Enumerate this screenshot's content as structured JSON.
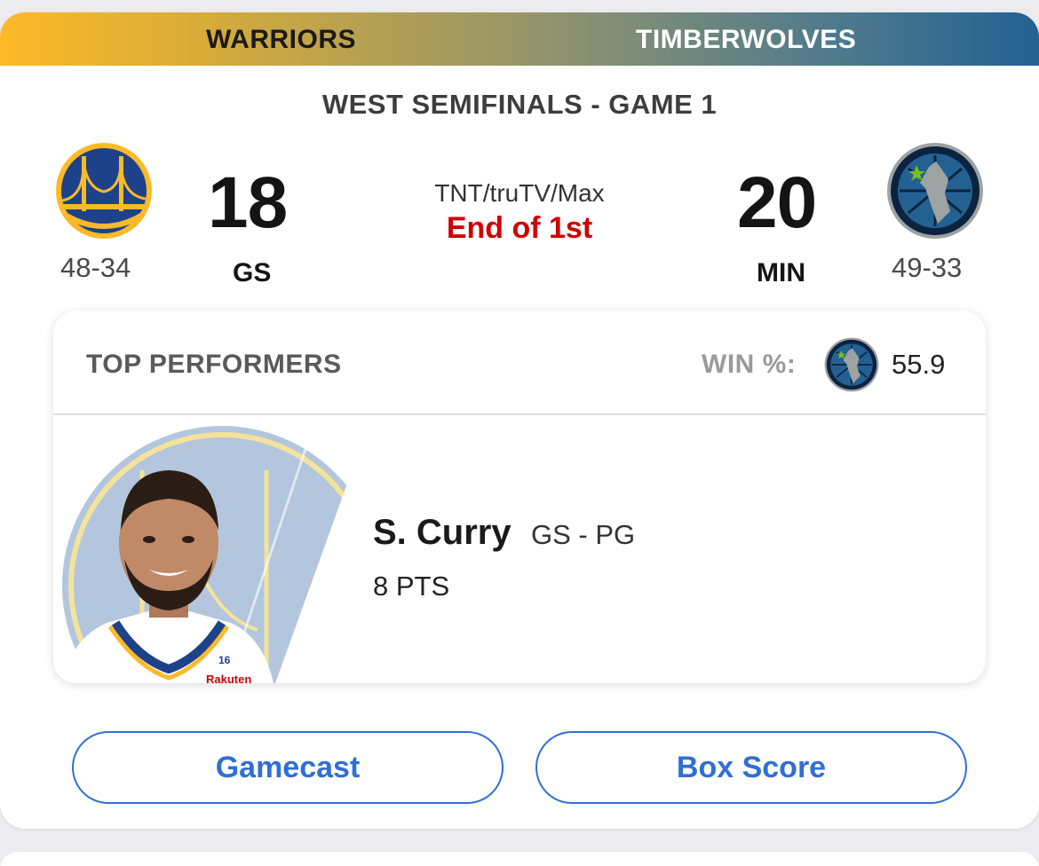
{
  "matchup": {
    "home_team_name": "WARRIORS",
    "away_team_name": "TIMBERWOLVES",
    "series": "WEST SEMIFINALS - GAME 1"
  },
  "home": {
    "score": "18",
    "abbr": "GS",
    "record": "48-34",
    "logo_icon": "warriors-logo-icon",
    "color": "#1d428a"
  },
  "away": {
    "score": "20",
    "abbr": "MIN",
    "record": "49-33",
    "logo_icon": "timberwolves-logo-icon",
    "color": "#0c2340"
  },
  "game": {
    "broadcast": "TNT/truTV/Max",
    "status": "End of 1st",
    "status_color": "#d00000"
  },
  "top_performers": {
    "title": "TOP PERFORMERS",
    "win_label": "WIN %:",
    "win_value": "55.9",
    "player": {
      "name": "S. Curry",
      "team_pos": "GS - PG",
      "stat": "8 PTS",
      "jersey_number": "16",
      "jersey_sponsor": "Rakuten"
    }
  },
  "buttons": {
    "gamecast": "Gamecast",
    "box_score": "Box Score"
  },
  "colors": {
    "accent": "#2f6fd6",
    "warriors_gold": "#fdb927",
    "warriors_blue": "#1d428a",
    "wolves_blue": "#236192"
  }
}
